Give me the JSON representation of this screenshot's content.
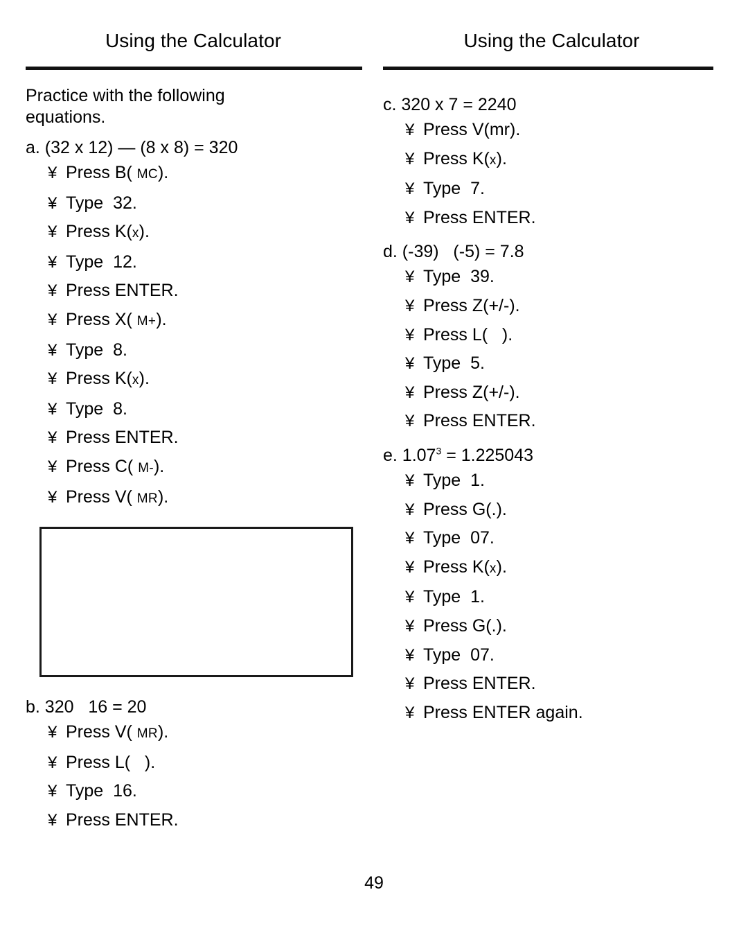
{
  "page": {
    "number": "49",
    "bullet_glyph": "¥"
  },
  "left_column": {
    "heading": "Using the Calculator",
    "intro": "Practice with the following equations.",
    "items": [
      {
        "equation": "a. (32 x 12) — (8 x 8) = 320",
        "steps": [
          {
            "pre": "Press B( ",
            "sc": "MC",
            "post": ")."
          },
          {
            "pre": "Type  32.",
            "sc": "",
            "post": ""
          },
          {
            "pre": "Press K(",
            "sc": "x",
            "post": ")."
          },
          {
            "pre": "Type  12.",
            "sc": "",
            "post": ""
          },
          {
            "pre": "Press ENTER.",
            "sc": "",
            "post": ""
          },
          {
            "pre": "Press X( ",
            "sc": "M+",
            "post": ")."
          },
          {
            "pre": "Type  8.",
            "sc": "",
            "post": ""
          },
          {
            "pre": "Press K(",
            "sc": "x",
            "post": ")."
          },
          {
            "pre": "Type  8.",
            "sc": "",
            "post": ""
          },
          {
            "pre": "Press ENTER.",
            "sc": "",
            "post": ""
          },
          {
            "pre": "Press C( ",
            "sc": "M-",
            "post": ")."
          },
          {
            "pre": "Press V( ",
            "sc": "MR",
            "post": ")."
          }
        ]
      },
      {
        "equation": "b. 320   16 = 20",
        "steps": [
          {
            "pre": "Press V( ",
            "sc": "MR",
            "post": ")."
          },
          {
            "pre": "Press L(   ).",
            "sc": "",
            "post": ""
          },
          {
            "pre": "Type  16.",
            "sc": "",
            "post": ""
          },
          {
            "pre": "Press ENTER.",
            "sc": "",
            "post": ""
          }
        ]
      }
    ],
    "answer_box": ""
  },
  "right_column": {
    "heading": "Using the Calculator",
    "items": [
      {
        "equation": "c. 320 x 7 = 2240",
        "steps": [
          {
            "pre": "Press V(mr).",
            "sc": "",
            "post": ""
          },
          {
            "pre": "Press K(",
            "sc": "x",
            "post": ")."
          },
          {
            "pre": "Type  7.",
            "sc": "",
            "post": ""
          },
          {
            "pre": "Press ENTER.",
            "sc": "",
            "post": ""
          }
        ]
      },
      {
        "equation": "d. (-39)   (-5) = 7.8",
        "steps": [
          {
            "pre": "Type  39.",
            "sc": "",
            "post": ""
          },
          {
            "pre": "Press Z(+/-).",
            "sc": "",
            "post": ""
          },
          {
            "pre": "Press L(   ).",
            "sc": "",
            "post": ""
          },
          {
            "pre": "Type  5.",
            "sc": "",
            "post": ""
          },
          {
            "pre": "Press Z(+/-).",
            "sc": "",
            "post": ""
          },
          {
            "pre": "Press ENTER.",
            "sc": "",
            "post": ""
          }
        ]
      },
      {
        "equation_pre": "e. 1.07",
        "equation_sup": "3",
        "equation_post": " = 1.225043",
        "steps": [
          {
            "pre": "Type  1.",
            "sc": "",
            "post": ""
          },
          {
            "pre": "Press G(.).",
            "sc": "",
            "post": ""
          },
          {
            "pre": "Type  07.",
            "sc": "",
            "post": ""
          },
          {
            "pre": "Press K(",
            "sc": "x",
            "post": ")."
          },
          {
            "pre": "Type  1.",
            "sc": "",
            "post": ""
          },
          {
            "pre": "Press G(.).",
            "sc": "",
            "post": ""
          },
          {
            "pre": "Type  07.",
            "sc": "",
            "post": ""
          },
          {
            "pre": "Press ENTER.",
            "sc": "",
            "post": ""
          },
          {
            "pre": "Press ENTER again.",
            "sc": "",
            "post": ""
          }
        ]
      }
    ]
  }
}
